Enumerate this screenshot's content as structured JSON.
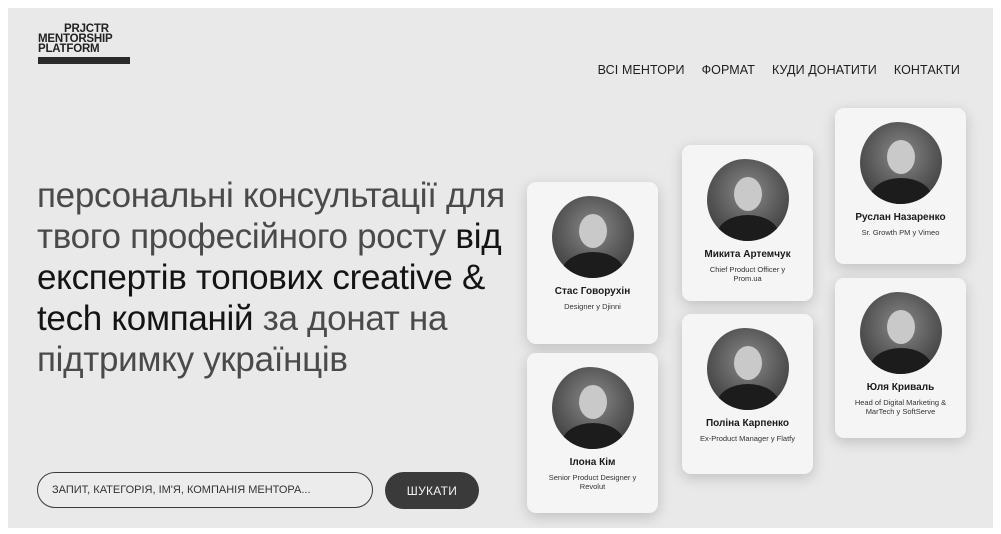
{
  "logo": {
    "line1": "PRJCTR",
    "line2": "MENTORSHIP",
    "line3": "PLATFORM"
  },
  "nav": {
    "items": [
      {
        "label": "ВСІ МЕНТОРИ"
      },
      {
        "label": "ФОРМАТ"
      },
      {
        "label": "КУДИ ДОНАТИТИ"
      },
      {
        "label": "КОНТАКТИ"
      }
    ]
  },
  "hero": {
    "part1": "персональні консультації для твого професійного росту ",
    "part2": "від експертів топових creative & tech компаній",
    "part3": " за донат на підтримку українців"
  },
  "search": {
    "placeholder": "ЗАПИТ, КАТЕГОРІЯ, ІМ'Я, КОМПАНІЯ МЕНТОРА...",
    "button_label": "ШУКАТИ"
  },
  "mentors": [
    {
      "name": "Стас Говорухін",
      "role": "Designer у Djinni"
    },
    {
      "name": "Ілона Кім",
      "role": "Senior Product Designer у Revolut"
    },
    {
      "name": "Микита Артемчук",
      "role": "Chief Product Officer у Prom.ua"
    },
    {
      "name": "Поліна Карпенко",
      "role": "Ex-Product Manager у Flatfy"
    },
    {
      "name": "Руслан Назаренко",
      "role": "Sr. Growth PM у Vimeo"
    },
    {
      "name": "Юля Криваль",
      "role": "Head of Digital Marketing & MarTech у SoftServe"
    }
  ]
}
